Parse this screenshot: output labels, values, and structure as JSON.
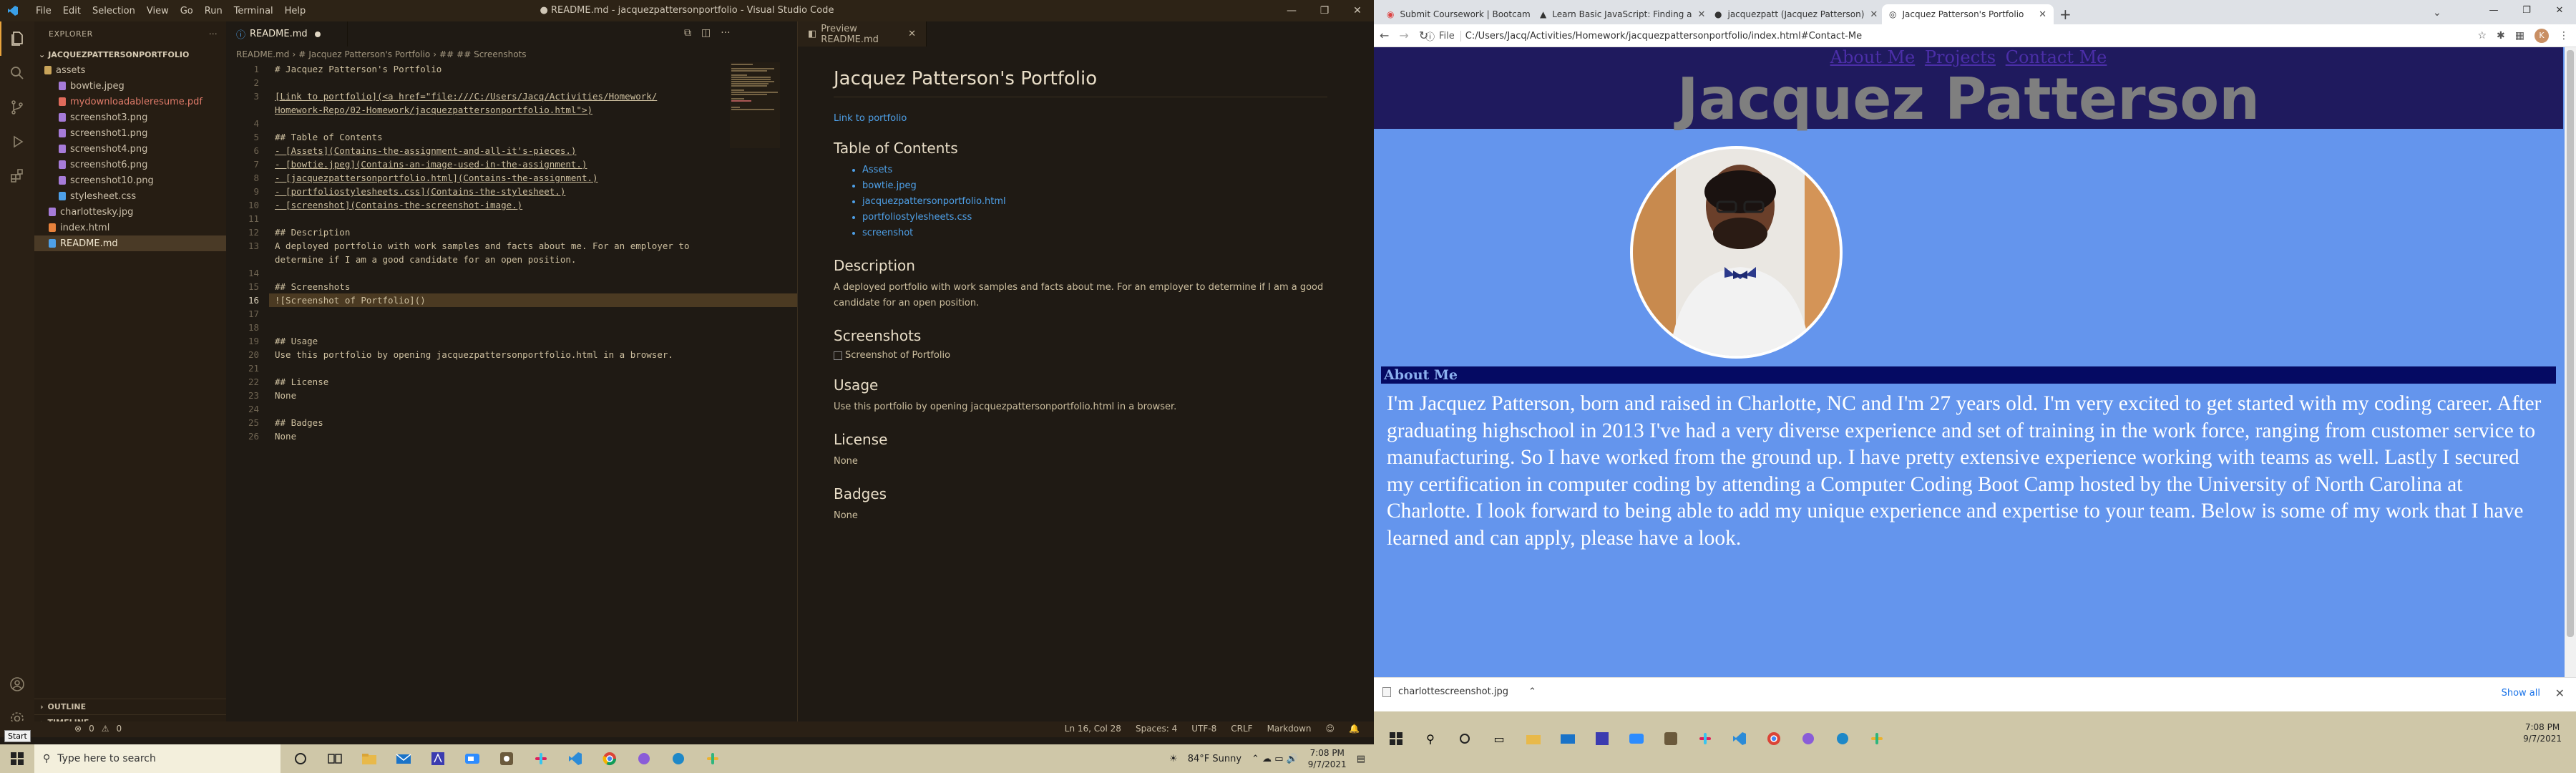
{
  "vscode": {
    "window_title": "● README.md - jacquezpattersonportfolio - Visual Studio Code",
    "menu": [
      "File",
      "Edit",
      "Selection",
      "View",
      "Go",
      "Run",
      "Terminal",
      "Help"
    ],
    "explorer_label": "EXPLORER",
    "project_folder": "JACQUEZPATTERSONPORTFOLIO",
    "files": [
      {
        "name": "assets",
        "type": "folder-open"
      },
      {
        "name": "bowtie.jpeg",
        "type": "image",
        "indent": 2
      },
      {
        "name": "mydownloadableresume.pdf",
        "type": "pdf",
        "indent": 2
      },
      {
        "name": "screenshot3.png",
        "type": "image",
        "indent": 2
      },
      {
        "name": "screenshot1.png",
        "type": "image",
        "indent": 2
      },
      {
        "name": "screenshot4.png",
        "type": "image",
        "indent": 2
      },
      {
        "name": "screenshot6.png",
        "type": "image",
        "indent": 2
      },
      {
        "name": "screenshot10.png",
        "type": "image",
        "indent": 2
      },
      {
        "name": "stylesheet.css",
        "type": "css",
        "indent": 2
      },
      {
        "name": "charlottesky.jpg",
        "type": "image",
        "indent": 1
      },
      {
        "name": "index.html",
        "type": "html",
        "indent": 1
      },
      {
        "name": "README.md",
        "type": "md",
        "indent": 1,
        "selected": true
      }
    ],
    "outline_label": "OUTLINE",
    "timeline_label": "TIMELINE",
    "tab_readme": "README.md",
    "tab_preview": "Preview README.md",
    "breadcrumb": [
      "README.md",
      "#",
      "Jacquez Patterson's Portfolio",
      "##",
      "## Screenshots"
    ],
    "code_lines": [
      "# Jacquez Patterson's Portfolio",
      "",
      "[Link to portfolio](<a href=\"file:///C:/Users/Jacq/Activities/Homework/",
      "Homework-Repo/02-Homework/jacquezpattersonportfolio.html\">)",
      "",
      "## Table of Contents",
      "- [Assets](Contains-the-assignment-and-all-it's-pieces.)",
      "- [bowtie.jpeg](Contains-an-image-used-in-the-assignment.)",
      "- [jacquezpattersonportfolio.html](Contains-the-assignment.)",
      "- [portfoliostylesheets.css](Contains-the-stylesheet.)",
      "- [screenshot](Contains-the-screenshot-image.)",
      "",
      "## Description",
      "A deployed portfolio with work samples and facts about me. For an employer to",
      "determine if I am a good candidate for an open position.",
      "",
      "## Screenshots",
      "![Screenshot of Portfolio]()",
      "",
      "",
      "## Usage",
      "Use this portfolio by opening jacquezpattersonportfolio.html in a browser.",
      "",
      "## License",
      "None",
      "",
      "## Badges",
      "None"
    ],
    "line_numbers": [
      "1",
      "2",
      "3",
      "",
      "4",
      "5",
      "6",
      "7",
      "8",
      "9",
      "10",
      "11",
      "12",
      "13",
      "",
      "14",
      "15",
      "16",
      "17",
      "18",
      "19",
      "20",
      "21",
      "22",
      "23",
      "24",
      "25",
      "26"
    ],
    "preview": {
      "h1": "Jacquez Patterson's Portfolio",
      "link": "Link to portfolio",
      "toc_heading": "Table of Contents",
      "toc": [
        "Assets",
        "bowtie.jpeg",
        "jacquezpattersonportfolio.html",
        "portfoliostylesheets.css",
        "screenshot"
      ],
      "description_heading": "Description",
      "description": "A deployed portfolio with work samples and facts about me. For an employer to determine if I am a good candidate for an open position.",
      "screenshots_heading": "Screenshots",
      "screenshot_alt": "Screenshot of Portfolio",
      "usage_heading": "Usage",
      "usage": "Use this portfolio by opening jacquezpattersonportfolio.html in a browser.",
      "license_heading": "License",
      "license": "None",
      "badges_heading": "Badges",
      "badges": "None"
    },
    "status": {
      "errors": "0",
      "warnings": "0",
      "position": "Ln 16, Col 28",
      "spaces": "Spaces: 4",
      "encoding": "UTF-8",
      "eol": "CRLF",
      "language": "Markdown"
    },
    "start_tooltip": "Start"
  },
  "taskbar_left": {
    "search_placeholder": "Type here to search",
    "weather": "84°F  Sunny",
    "time": "7:08 PM",
    "date": "9/7/2021"
  },
  "chrome": {
    "tabs": [
      {
        "title": "Submit Coursework | Bootcamp"
      },
      {
        "title": "Learn Basic JavaScript: Finding a"
      },
      {
        "title": "jacquezpatt (Jacquez Patterson)"
      },
      {
        "title": "Jacquez Patterson's Portfolio",
        "active": true
      }
    ],
    "address_prefix": "File",
    "address": "C:/Users/Jacq/Activities/Homework/jacquezpattersonportfolio/index.html#Contact-Me",
    "avatar_letter": "K",
    "site": {
      "nav": [
        "About Me",
        "Projects",
        "Contact Me"
      ],
      "title": "Jacquez Patterson",
      "about_heading": "About Me",
      "about_text": "I'm Jacquez Patterson, born and raised in Charlotte, NC and I'm 27 years old. I'm very excited to get started with my coding career. After graduating highschool in 2013 I've had a very diverse experience and set of training in the work force, ranging from customer service to manufacturing. So I have worked from the ground up. I have pretty extensive experience working with teams as well. Lastly I secured my certification in computer coding by attending a Computer Coding Boot Camp hosted by the University of North Carolina at Charlotte. I look forward to being able to add my unique experience and expertise to your team. Below is some of my work that I have learned and can apply, please have a look."
    },
    "download_file": "charlottescreenshot.jpg",
    "show_all": "Show all"
  },
  "taskbar_right": {
    "time": "7:08 PM",
    "date": "9/7/2021"
  },
  "colors": {
    "vscode_bg": "#1f1a14",
    "accent": "#e8a33c",
    "site_bg": "#6495ed",
    "site_header": "#1f1a5e",
    "about_bar": "#050a63"
  }
}
